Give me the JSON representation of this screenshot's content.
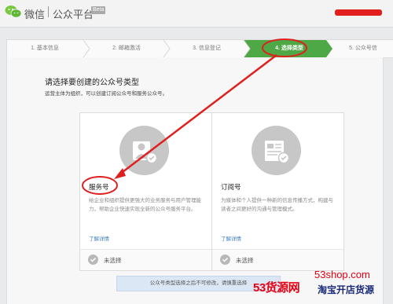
{
  "header": {
    "brand": "微信",
    "product": "公众平台",
    "badge": "Beta"
  },
  "steps": [
    {
      "label": "1. 基本信息",
      "active": false
    },
    {
      "label": "2. 邮箱激活",
      "active": false
    },
    {
      "label": "3. 信息登记",
      "active": false
    },
    {
      "label": "4. 选择类型",
      "active": true
    },
    {
      "label": "5. 公众号信",
      "active": false
    }
  ],
  "main": {
    "title": "请选择要创建的公众号类型",
    "subtitle": "运营主体为组织，可以创建订阅公众号和服务公众号。"
  },
  "cards": [
    {
      "name": "服务号",
      "icon": "user-badge-icon",
      "desc": "给企业和组织提供更强大的业务服务与用户管理能力，帮助企业快速实现全新的公众号服务平台。",
      "link": "了解详情",
      "status": "未选择"
    },
    {
      "name": "订阅号",
      "icon": "news-document-icon",
      "desc": "为媒体和个人提供一种新的信息传播方式，构建与读者之间更好的沟通与管理模式。",
      "link": "了解详情",
      "status": "未选择"
    }
  ],
  "notice": "公众号类型选择之后不可修改，请慎重选择",
  "watermark": {
    "brand": "53货源网",
    "url": "53shop.com",
    "slogan": "淘宝开店货源"
  },
  "colors": {
    "active_step": "#4fa846",
    "annotation": "#e0201e",
    "link": "#3b7ec2"
  }
}
